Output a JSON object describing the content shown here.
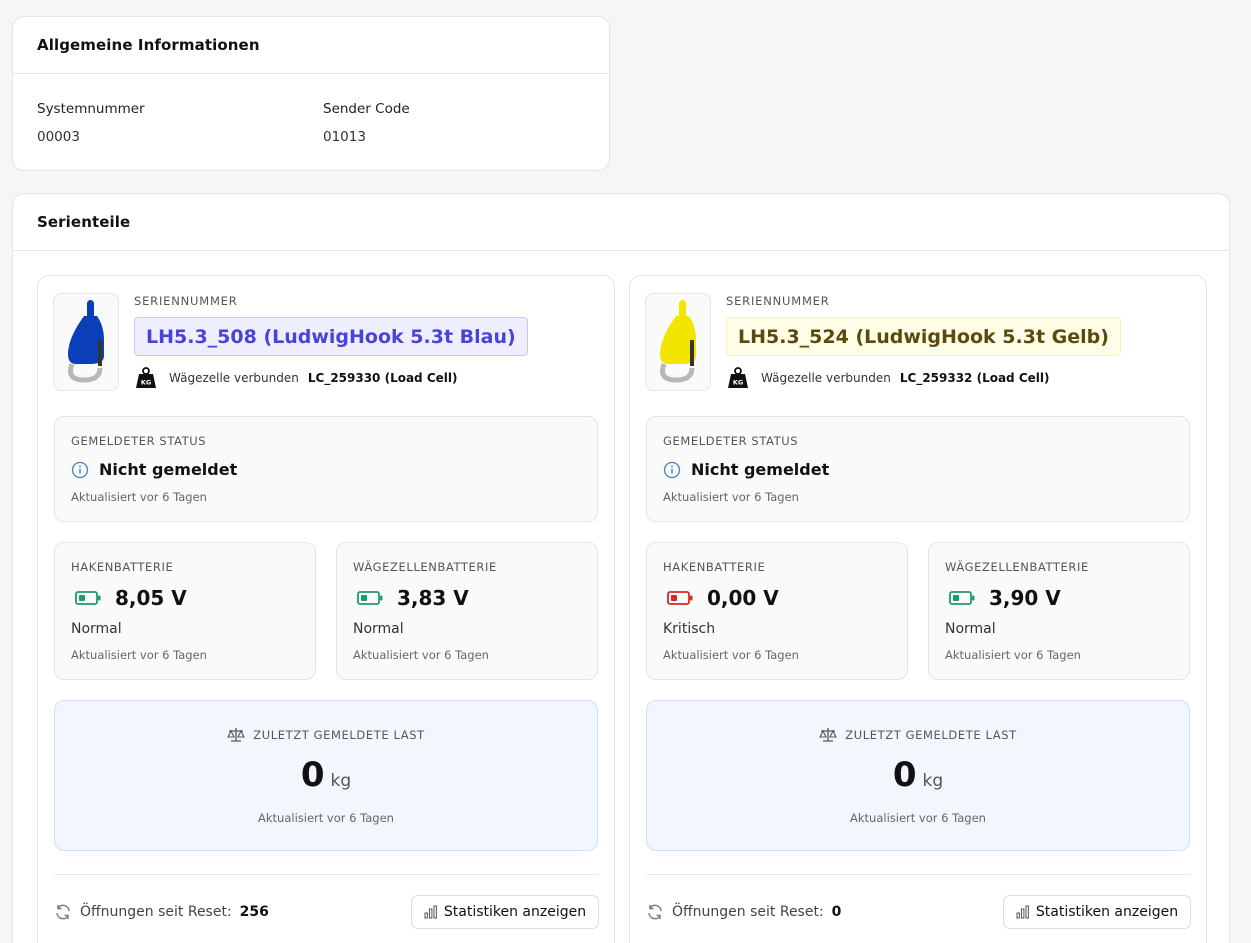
{
  "info": {
    "title": "Allgemeine Informationen",
    "system_label": "Systemnummer",
    "system_value": "00003",
    "sender_label": "Sender Code",
    "sender_value": "01013"
  },
  "parts_section": {
    "title": "Serienteile"
  },
  "parts": [
    {
      "serial_caption": "SERIENNUMMER",
      "serial": "LH5.3_508 (LudwigHook 5.3t Blau)",
      "hook_color": "#0a3fb8",
      "pill_bg": "#eeeeff",
      "pill_border": "#c9c8f3",
      "pill_text": "#4a43d8",
      "loadcell_label": "Wägezelle verbunden",
      "loadcell_value": "LC_259330 (Load Cell)",
      "status_caption": "GEMELDETER STATUS",
      "status_text": "Nicht gemeldet",
      "status_updated": "Aktualisiert vor 6 Tagen",
      "hook_battery": {
        "caption": "HAKENBATTERIE",
        "value": "8,05 V",
        "state": "Normal",
        "updated": "Aktualisiert vor 6 Tagen",
        "color": "#1f9a6a"
      },
      "cell_battery": {
        "caption": "WÄGEZELLENBATTERIE",
        "value": "3,83 V",
        "state": "Normal",
        "updated": "Aktualisiert vor 6 Tagen",
        "color": "#1f9a6a"
      },
      "load_caption": "ZULETZT GEMELDETE LAST",
      "load_value": "0",
      "load_unit": "kg",
      "load_updated": "Aktualisiert vor 6 Tagen",
      "openings_label": "Öffnungen seit Reset:",
      "openings_count": "256",
      "stats_label": "Statistiken anzeigen"
    },
    {
      "serial_caption": "SERIENNUMMER",
      "serial": "LH5.3_524 (LudwigHook 5.3t Gelb)",
      "hook_color": "#f2e600",
      "pill_bg": "#fffde6",
      "pill_border": "#f6f0c4",
      "pill_text": "#5a4a10",
      "loadcell_label": "Wägezelle verbunden",
      "loadcell_value": "LC_259332 (Load Cell)",
      "status_caption": "GEMELDETER STATUS",
      "status_text": "Nicht gemeldet",
      "status_updated": "Aktualisiert vor 6 Tagen",
      "hook_battery": {
        "caption": "HAKENBATTERIE",
        "value": "0,00 V",
        "state": "Kritisch",
        "updated": "Aktualisiert vor 6 Tagen",
        "color": "#d62828"
      },
      "cell_battery": {
        "caption": "WÄGEZELLENBATTERIE",
        "value": "3,90 V",
        "state": "Normal",
        "updated": "Aktualisiert vor 6 Tagen",
        "color": "#1f9a6a"
      },
      "load_caption": "ZULETZT GEMELDETE LAST",
      "load_value": "0",
      "load_unit": "kg",
      "load_updated": "Aktualisiert vor 6 Tagen",
      "openings_label": "Öffnungen seit Reset:",
      "openings_count": "0",
      "stats_label": "Statistiken anzeigen"
    }
  ]
}
